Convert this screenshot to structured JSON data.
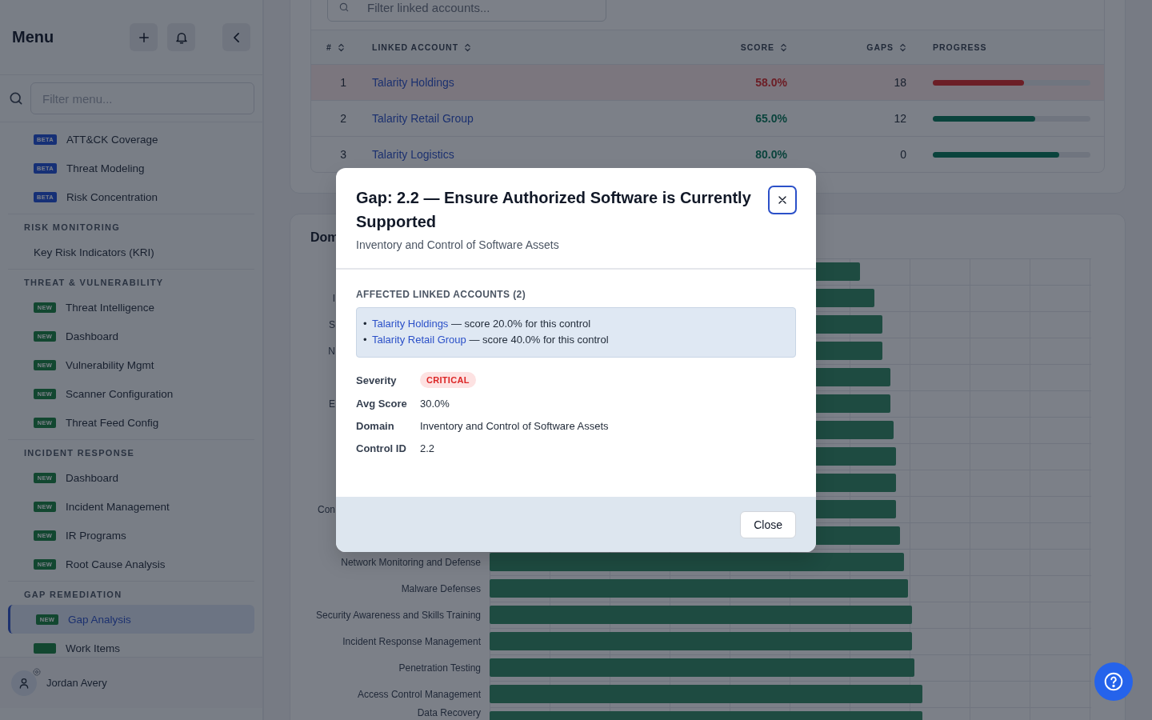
{
  "sidebar": {
    "title": "Menu",
    "search": {
      "placeholder": "Filter menu..."
    },
    "sections": [
      {
        "items": [
          {
            "label": "ATT&CK Coverage",
            "badge": {
              "text": "BETA",
              "kind": "beta"
            },
            "selected": false
          },
          {
            "label": "Threat Modeling",
            "badge": {
              "text": "BETA",
              "kind": "beta"
            },
            "selected": false
          },
          {
            "label": "Risk Concentration",
            "badge": {
              "text": "BETA",
              "kind": "beta"
            },
            "selected": false
          }
        ]
      },
      {
        "heading": "RISK MONITORING",
        "items": [
          {
            "label": "Key Risk Indicators (KRI)",
            "selected": false
          }
        ]
      },
      {
        "heading": "THREAT & VULNERABILITY",
        "items": [
          {
            "label": "Threat Intelligence",
            "badge": {
              "text": "NEW",
              "kind": "new"
            },
            "selected": false
          },
          {
            "label": "Dashboard",
            "badge": {
              "text": "NEW",
              "kind": "new"
            },
            "selected": false
          },
          {
            "label": "Vulnerability Mgmt",
            "badge": {
              "text": "NEW",
              "kind": "new"
            },
            "selected": false
          },
          {
            "label": "Scanner Configuration",
            "badge": {
              "text": "NEW",
              "kind": "new"
            },
            "selected": false
          },
          {
            "label": "Threat Feed Config",
            "badge": {
              "text": "NEW",
              "kind": "new"
            },
            "selected": false
          }
        ]
      },
      {
        "heading": "INCIDENT RESPONSE",
        "items": [
          {
            "label": "Dashboard",
            "badge": {
              "text": "NEW",
              "kind": "new"
            },
            "selected": false
          },
          {
            "label": "Incident Management",
            "badge": {
              "text": "NEW",
              "kind": "new"
            },
            "selected": false
          },
          {
            "label": "IR Programs",
            "badge": {
              "text": "NEW",
              "kind": "new"
            },
            "selected": false
          },
          {
            "label": "Root Cause Analysis",
            "badge": {
              "text": "NEW",
              "kind": "new"
            },
            "selected": false
          }
        ]
      },
      {
        "heading": "GAP REMEDIATION",
        "items": [
          {
            "label": "Gap Analysis",
            "badge": {
              "text": "NEW",
              "kind": "new"
            },
            "selected": true
          },
          {
            "label": "Work Items",
            "badge": {
              "kind": "new"
            },
            "selected": false
          }
        ]
      }
    ],
    "user": {
      "name": "Jordan Avery"
    }
  },
  "accounts_table": {
    "filter": {
      "placeholder": "Filter linked accounts..."
    },
    "columns": [
      {
        "label": "#",
        "sortable": true
      },
      {
        "label": "LINKED ACCOUNT",
        "sortable": true
      },
      {
        "label": "SCORE",
        "sortable": true
      },
      {
        "label": "GAPS",
        "sortable": true
      },
      {
        "label": "PROGRESS",
        "sortable": false
      }
    ],
    "rows": [
      {
        "number": "1",
        "account": "Talarity Holdings",
        "score": "58.0%",
        "gaps": "18",
        "level": 0.58,
        "highlighted": true
      },
      {
        "number": "2",
        "account": "Talarity Retail Group",
        "score": "65.0%",
        "gaps": "12",
        "level": 0.65,
        "highlighted": false
      },
      {
        "number": "3",
        "account": "Talarity Logistics",
        "score": "80.0%",
        "gaps": "0",
        "level": 0.8,
        "highlighted": false
      }
    ]
  },
  "domain_chart": {
    "title": "Dom",
    "rows": [
      {
        "kind": "hidden"
      },
      {
        "kind": "cut",
        "label": "I"
      },
      {
        "kind": "cut",
        "label": "S"
      },
      {
        "kind": "cut",
        "label": "N"
      },
      {
        "kind": "hidden"
      },
      {
        "kind": "cut",
        "label": "E"
      },
      {
        "kind": "hidden"
      },
      {
        "kind": "hidden"
      },
      {
        "kind": "hidden"
      },
      {
        "kind": "cut",
        "label": "Con"
      },
      {
        "kind": "hidden"
      },
      {
        "kind": "full",
        "label": "Network Monitoring and Defense"
      },
      {
        "kind": "full",
        "label": "Malware Defenses"
      },
      {
        "kind": "full",
        "label": "Security Awareness and Skills Training"
      },
      {
        "kind": "full",
        "label": "Incident Response Management"
      },
      {
        "kind": "full",
        "label": "Penetration Testing"
      },
      {
        "kind": "full",
        "label": "Access Control Management"
      },
      {
        "kind": "full",
        "label": "Data Recovery"
      }
    ]
  },
  "modal": {
    "title": "Gap: 2.2 — Ensure Authorized Software is Currently Supported",
    "subtitle": "Inventory and Control of Software Assets",
    "section_heading": "AFFECTED LINKED ACCOUNTS (2)",
    "accounts": [
      {
        "marker": "•",
        "name": "Talarity Holdings",
        "note": "— score 20.0% for this control"
      },
      {
        "marker": "•",
        "name": "Talarity Retail Group",
        "note": "— score 40.0% for this control"
      }
    ],
    "details": [
      {
        "label": "Severity",
        "value": "CRITICAL",
        "kind": "badge"
      },
      {
        "label": "Avg Score",
        "value": "30.0%",
        "kind": "text"
      },
      {
        "label": "Domain",
        "value": "Inventory and Control of Software Assets",
        "kind": "text"
      },
      {
        "label": "Control ID",
        "value": "2.2",
        "kind": "text"
      }
    ],
    "buttons": [
      "Close"
    ]
  }
}
